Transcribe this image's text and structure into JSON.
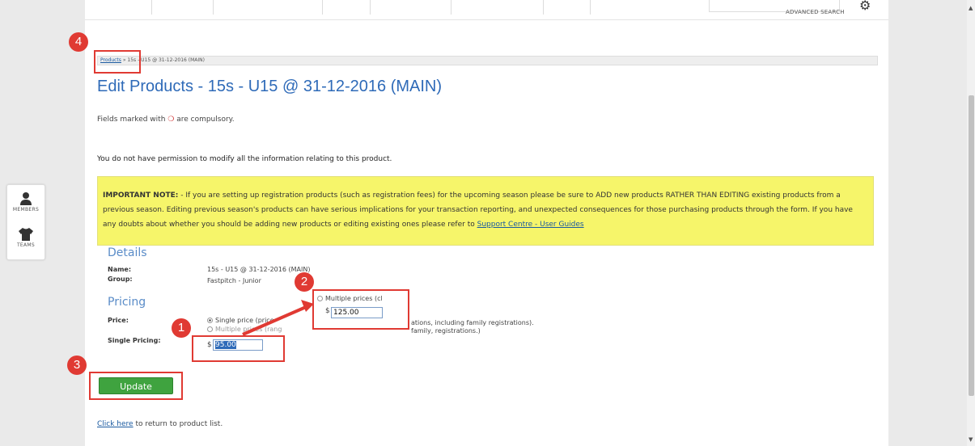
{
  "header": {
    "advanced_search": "ADVANCED SEARCH"
  },
  "sidebar": {
    "items": [
      {
        "label": "MEMBERS",
        "icon": "person-icon"
      },
      {
        "label": "TEAMS",
        "icon": "shirt-icon"
      }
    ]
  },
  "breadcrumb": {
    "link": "Products",
    "rest": " » 15s - U15 @ 31-12-2016 (MAIN)"
  },
  "page_title": "Edit Products - 15s - U15 @ 31-12-2016 (MAIN)",
  "compulsory": {
    "before": "Fields marked with ",
    "after": " are compulsory."
  },
  "permission_text": "You do not have permission to modify all the information relating to this product.",
  "note": {
    "label": "IMPORTANT NOTE:",
    "text": " - If you are setting up registration products (such as registration fees) for the upcoming season please be sure to ADD new products RATHER THAN EDITING existing products from a previous season. Editing previous season's products can have serious implications for your transaction reporting, and unexpected consequences for those purchasing products through the form. If you have any doubts about whether you should be adding new products or editing existing ones please refer to ",
    "link": "Support Centre - User Guides"
  },
  "details": {
    "heading": "Details",
    "name_label": "Name:",
    "name_value": "15s - U15 @ 31-12-2016 (MAIN)",
    "group_label": "Group:",
    "group_value": "Fastpitch - Junior"
  },
  "pricing": {
    "heading": "Pricing",
    "price_label": "Price:",
    "option_single": "Single price (price",
    "option_single_tail": "ations, including family registrations).",
    "option_multiple": "Multiple prices (rang",
    "option_multiple_tail": "family, registrations.)",
    "single_pricing_label": "Single Pricing:",
    "currency": "$",
    "single_value": "95.00"
  },
  "popup": {
    "option_multiple": "Multiple prices (cl",
    "currency": "$",
    "value": "125.00"
  },
  "annotations": {
    "badge1": "1",
    "badge2": "2",
    "badge3": "3",
    "badge4": "4"
  },
  "update_label": "Update",
  "return": {
    "link": "Click here",
    "text": " to return to product list."
  },
  "colors": {
    "accent_red": "#e03a33",
    "note_yellow": "#f6f56a",
    "update_green": "#3fa33f",
    "title_blue": "#2e6ab8"
  }
}
